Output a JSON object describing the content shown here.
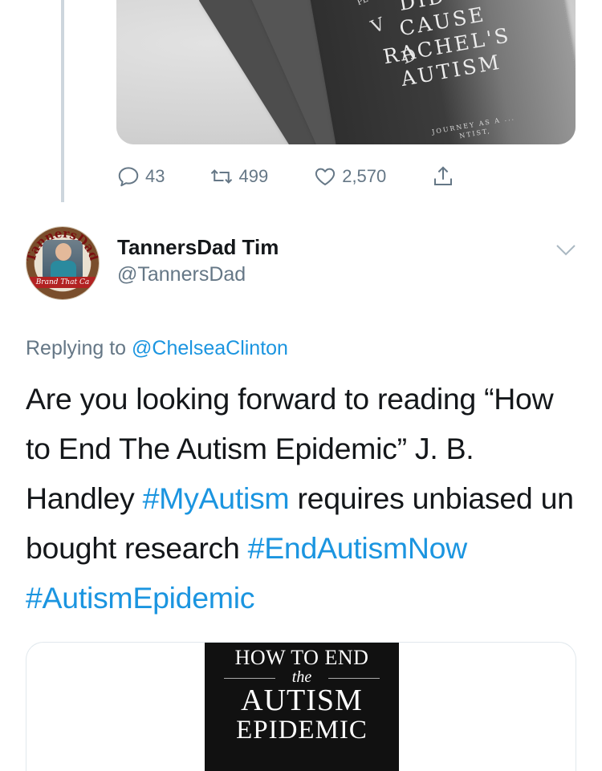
{
  "top_media": {
    "cover_lines": [
      "DID",
      "CAUSE",
      "RACHEL'S",
      "AUTISM"
    ],
    "cover_subtitle": "JOURNEY AS A ... NTIST,",
    "spine_letters": [
      "V",
      "D",
      "PE"
    ]
  },
  "actions": {
    "replies": "43",
    "retweets": "499",
    "likes": "2,570"
  },
  "tweet": {
    "avatar_text": "TannersDad",
    "avatar_banner": "Brand That Ca",
    "display_name": "TannersDad Tim",
    "handle": "@TannersDad",
    "replying_label": "Replying to",
    "replying_handle": "@ChelseaClinton",
    "text_part1": "Are you looking forward to reading “How to End The Autism Epidemic” J. B. Handley ",
    "hashtag1": "#MyAutism",
    "text_part2": " requires unbiased un bought research ",
    "hashtag2": "#EndAutismNow",
    "hashtag3": "#AutismEpidemic"
  },
  "card": {
    "line1": "HOW TO END",
    "line2": "the",
    "line3": "AUTISM",
    "line4": "EPIDEMIC"
  },
  "colors": {
    "link": "#1b95e0",
    "secondary_text": "#657786",
    "primary_text": "#14171a",
    "thread_line": "#cdd6dd"
  }
}
